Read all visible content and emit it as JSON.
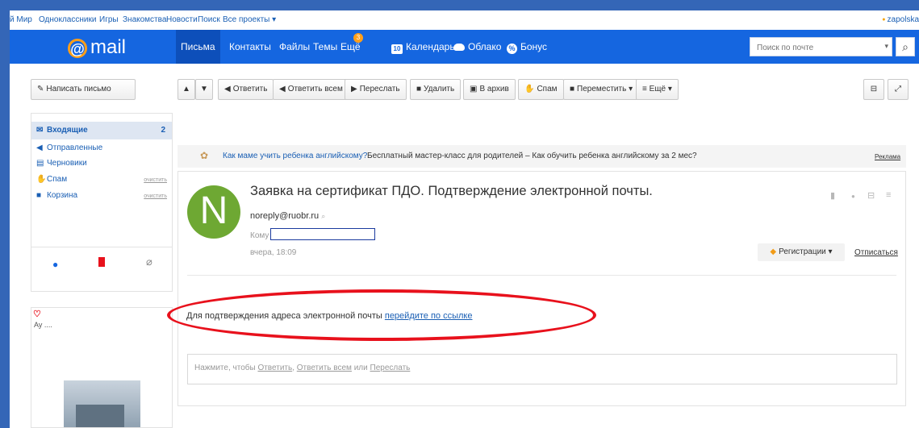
{
  "portal_links": [
    "й Мир",
    "Одноклассники",
    "Игры",
    "Знакомства",
    "Новости",
    "Поиск",
    "Все проекты ▾"
  ],
  "portal_user": "zapolska",
  "logo": {
    "symbol": "@",
    "text": "mail"
  },
  "nav": {
    "letters": "Письма",
    "contacts": "Контакты",
    "files": "Файлы",
    "themes": "Темы",
    "more": "Ещё",
    "more_badge": "3",
    "calendar_icon_text": "10",
    "calendar": "Календарь",
    "cloud": "Облако",
    "bonus": "Бонус"
  },
  "search": {
    "placeholder": "Поиск по почте",
    "dropdown": "▾",
    "button": "🔍"
  },
  "toolbar": {
    "compose": "Написать письмо",
    "reply": "Ответить",
    "reply_all": "Ответить всем",
    "forward": "Переслать",
    "delete": "Удалить",
    "archive": "В архив",
    "spam": "Спам",
    "move": "Переместить ▾",
    "more": "≡ Ещё ▾"
  },
  "folders": [
    {
      "label": "Входящие",
      "count": "2"
    },
    {
      "label": "Отправленные"
    },
    {
      "label": "Черновики"
    },
    {
      "label": "Спам",
      "action": "очистить"
    },
    {
      "label": "Корзина",
      "action": "очистить"
    }
  ],
  "ad_sidebar": {
    "text": "Ау ...."
  },
  "ad_bar": {
    "headline": "Как маме учить ребенка английскому?",
    "text": "Бесплатный мастер-класс для родителей – Как обучить ребенка английскому за 2 мес?",
    "label": "Реклама"
  },
  "email": {
    "avatar_letter": "N",
    "subject": "Заявка на сертификат ПДО. Подтверждение электронной почты.",
    "sender": "noreply@ruobr.ru",
    "to_label": "Кому",
    "date": "вчера, 18:09",
    "category": "Регистрации ▾",
    "unsubscribe": "Отписаться",
    "body_text": "Для подтверждения адреса электронной почты ",
    "body_link": "перейдите по ссылке"
  },
  "quick_reply": {
    "prefix": "Нажмите, чтобы ",
    "reply": "Ответить",
    "sep1": ", ",
    "reply_all": "Ответить всем",
    "sep2": " или ",
    "forward": "Переслать"
  },
  "accent_colors": {
    "header": "#1566e0",
    "logo_ring": "#ff9f1a",
    "avatar": "#6ea833",
    "annotation": "#e8111c",
    "frame": "#3466b7"
  }
}
